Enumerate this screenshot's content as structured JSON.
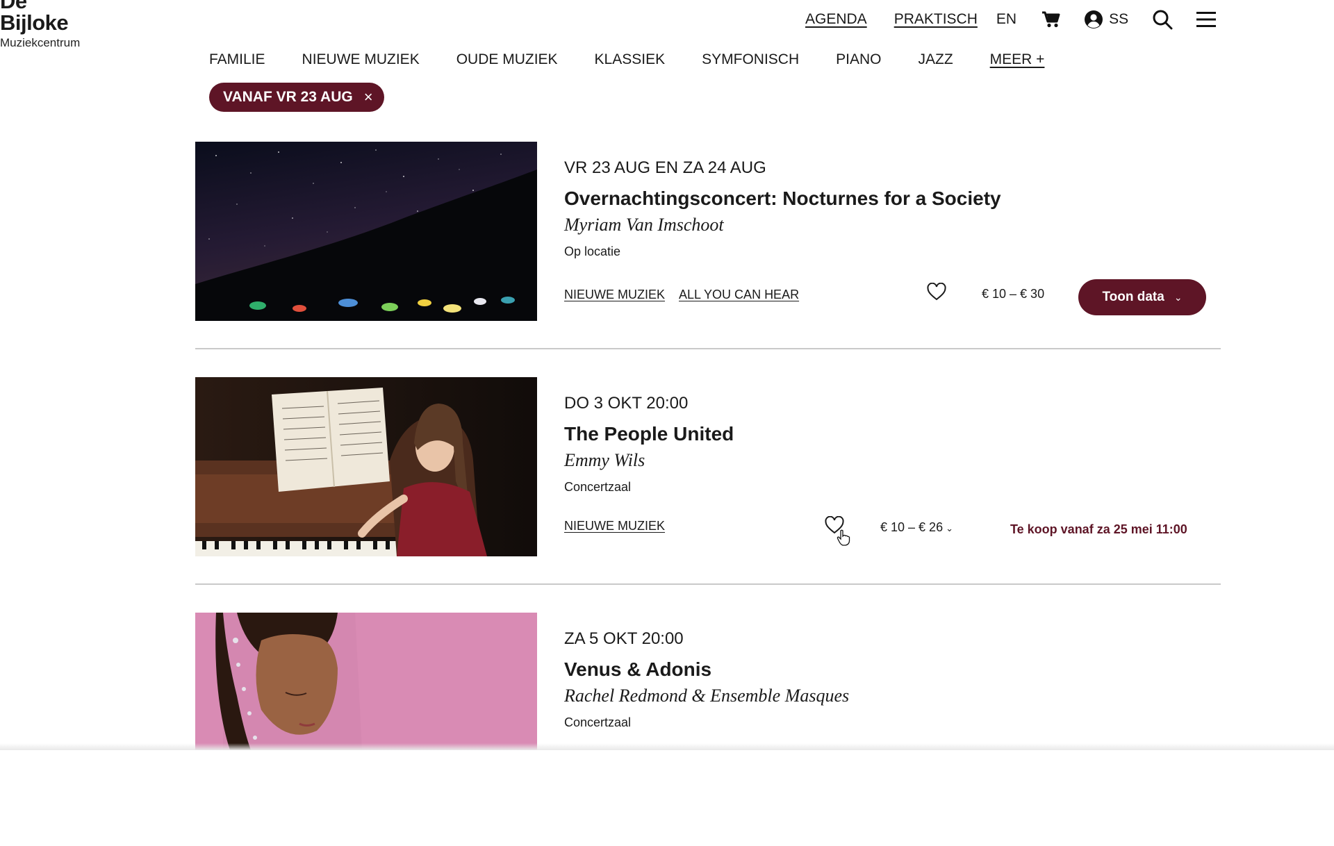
{
  "logo": {
    "line1": "De",
    "line2": "Bijloke",
    "line3": "Muziekcentrum"
  },
  "topnav": {
    "agenda": "AGENDA",
    "praktisch": "PRAKTISCH",
    "lang": "EN",
    "account_initials": "SS",
    "icons": [
      "cart-icon",
      "account-icon",
      "search-icon",
      "menu-icon"
    ]
  },
  "categories": [
    "FAMILIE",
    "NIEUWE MUZIEK",
    "OUDE MUZIEK",
    "KLASSIEK",
    "SYMFONISCH",
    "PIANO",
    "JAZZ",
    "MEER +"
  ],
  "filter_chip": {
    "label": "VANAF VR 23 AUG",
    "close": "×"
  },
  "events": [
    {
      "date": "VR 23 AUG EN ZA 24 AUG",
      "title": "Overnachtingsconcert: Nocturnes for a Society",
      "performer": "Myriam Van Imschoot",
      "venue": "Op locatie",
      "tags": [
        "NIEUWE MUZIEK",
        "ALL YOU CAN HEAR"
      ],
      "price": "€ 10 – € 30",
      "button": "Toon data"
    },
    {
      "date": "DO 3 OKT 20:00",
      "title": "The People United",
      "performer": "Emmy Wils",
      "venue": "Concertzaal",
      "tags": [
        "NIEUWE MUZIEK"
      ],
      "price": "€ 10 – € 26",
      "sale_note": "Te koop vanaf za 25 mei 11:00"
    },
    {
      "date": "ZA 5 OKT 20:00",
      "title": "Venus & Adonis",
      "performer": "Rachel Redmond & Ensemble Masques",
      "venue": "Concertzaal"
    }
  ],
  "colors": {
    "accent": "#5e1526",
    "text": "#1a1a1a",
    "divider": "#c9c9c9"
  }
}
